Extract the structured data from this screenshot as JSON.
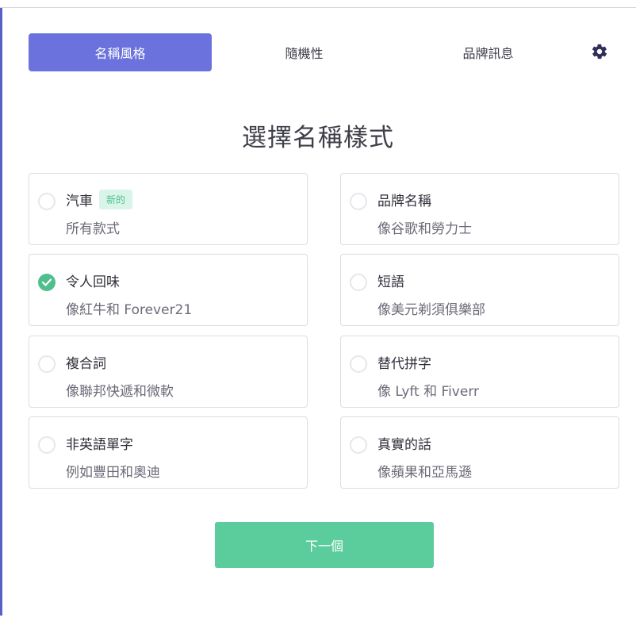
{
  "tabs": [
    {
      "label": "名稱風格",
      "active": true
    },
    {
      "label": "隨機性",
      "active": false
    },
    {
      "label": "品牌訊息",
      "active": false
    }
  ],
  "settings_icon": "gear-icon",
  "heading": "選擇名稱樣式",
  "options": [
    {
      "title": "汽車",
      "badge": "新的",
      "subtitle": "所有款式",
      "selected": false
    },
    {
      "title": "品牌名稱",
      "subtitle": "像谷歌和勞力士",
      "selected": false
    },
    {
      "title": "令人回味",
      "subtitle": "像紅牛和 Forever21",
      "selected": true
    },
    {
      "title": "短語",
      "subtitle": "像美元剃須俱樂部",
      "selected": false
    },
    {
      "title": "複合詞",
      "subtitle": "像聯邦快遞和微軟",
      "selected": false
    },
    {
      "title": "替代拼字",
      "subtitle": "像 Lyft 和 Fiverr",
      "selected": false
    },
    {
      "title": "非英語單字",
      "subtitle": "例如豐田和奧迪",
      "selected": false
    },
    {
      "title": "真實的話",
      "subtitle": "像蘋果和亞馬遜",
      "selected": false
    }
  ],
  "next_button": "下一個",
  "colors": {
    "accent": "#6b72dd",
    "success": "#5bcc9b",
    "check": "#4fbf8c",
    "badge_bg": "#d9f5ea"
  }
}
